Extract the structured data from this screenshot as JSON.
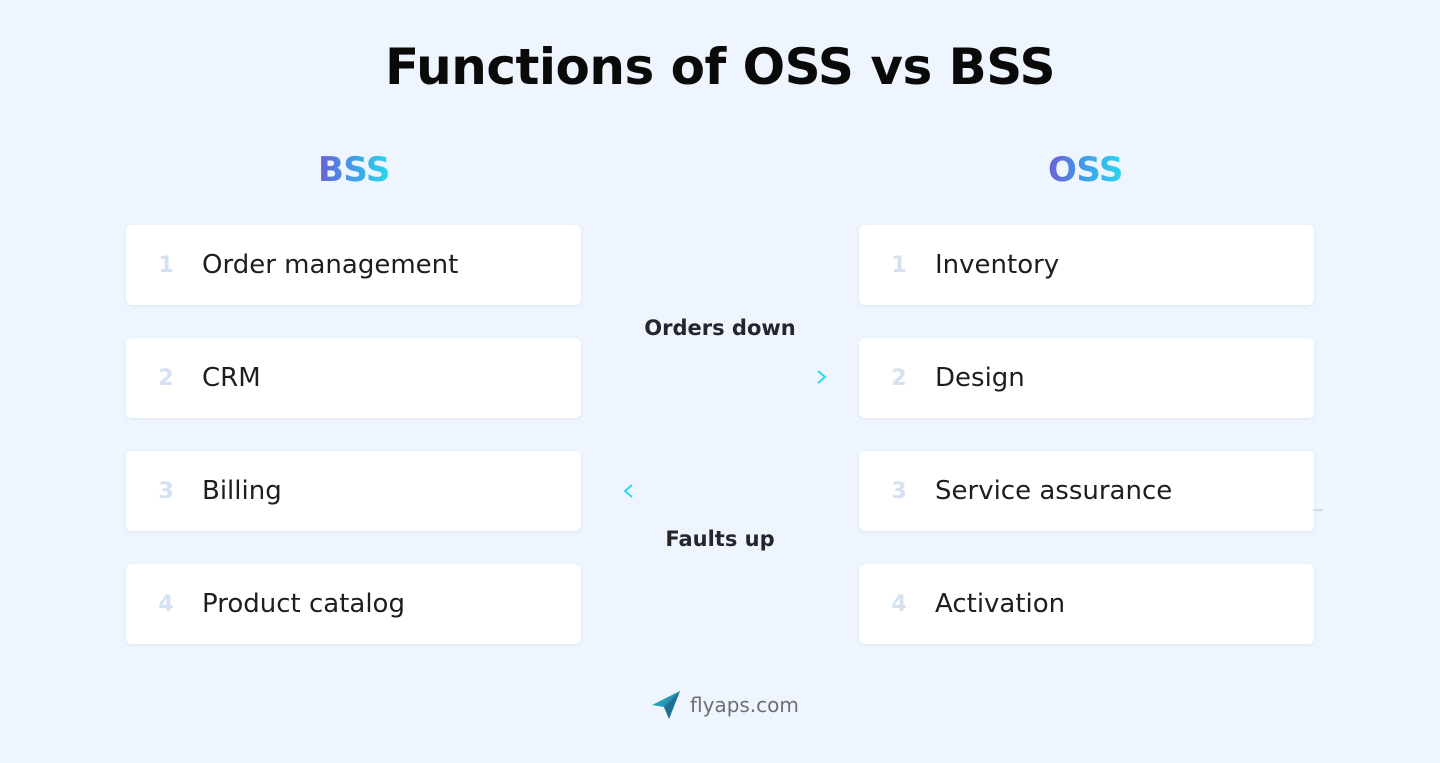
{
  "title": "Functions of OSS vs BSS",
  "colors": {
    "background": "#eef5fe",
    "gradient_start": "#6b5fd6",
    "gradient_end": "#2ad8ee",
    "number": "#d3e1f1"
  },
  "bss": {
    "heading": "BSS",
    "items": [
      {
        "num": "1",
        "label": "Order management"
      },
      {
        "num": "2",
        "label": "CRM"
      },
      {
        "num": "3",
        "label": "Billing"
      },
      {
        "num": "4",
        "label": "Product catalog"
      }
    ]
  },
  "oss": {
    "heading": "OSS",
    "items": [
      {
        "num": "1",
        "label": "Inventory"
      },
      {
        "num": "2",
        "label": "Design"
      },
      {
        "num": "3",
        "label": "Service assurance"
      },
      {
        "num": "4",
        "label": "Activation"
      }
    ]
  },
  "flows": {
    "down": {
      "label": "Orders down",
      "direction": "BSS to OSS",
      "icon": "arrow-right-icon"
    },
    "up": {
      "label": "Faults up",
      "direction": "OSS to BSS",
      "icon": "arrow-left-icon"
    }
  },
  "footer": {
    "logo_icon": "paper-plane-icon",
    "site": "flyaps.com"
  }
}
